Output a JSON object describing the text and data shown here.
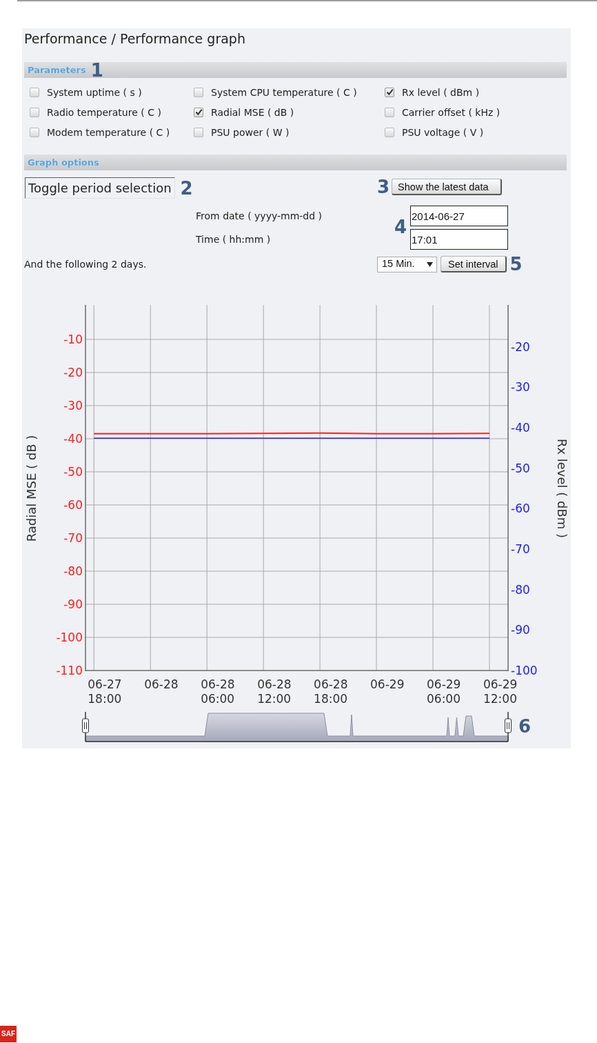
{
  "page_title": "Performance / Performance graph",
  "parameters": {
    "title": "Parameters",
    "callout": "1",
    "items": [
      {
        "label": "System uptime ( s )",
        "checked": false
      },
      {
        "label": "System CPU temperature ( C )",
        "checked": false
      },
      {
        "label": "Rx level ( dBm )",
        "checked": true
      },
      {
        "label": "Radio temperature ( C )",
        "checked": false
      },
      {
        "label": "Radial MSE ( dB )",
        "checked": true
      },
      {
        "label": "Carrier offset ( kHz )",
        "checked": false
      },
      {
        "label": "Modem temperature ( C )",
        "checked": false
      },
      {
        "label": "PSU power ( W )",
        "checked": false
      },
      {
        "label": "PSU voltage ( V )",
        "checked": false
      }
    ]
  },
  "graph_options": {
    "title": "Graph options",
    "period_toggle": {
      "label": "Toggle period selection",
      "callout": "2"
    },
    "latest_button": {
      "label": "Show the latest data",
      "callout": "3"
    },
    "fields": [
      {
        "label": "From date ( yyyy-mm-dd )",
        "value": "2014-06-27"
      },
      {
        "label": "Time ( hh:mm )",
        "value": "17:01"
      }
    ],
    "fields_callout": "4",
    "period_note": "And the following 2 days.",
    "interval": {
      "value": "15 Min.",
      "button": "Set interval",
      "callout": "5"
    }
  },
  "chart": {
    "chart_data": {
      "type": "line",
      "grid": true,
      "ylabel": "Radial MSE ( dB )",
      "y2label": "Rx level ( dBm )",
      "categories": [
        "06-27 18:00",
        "06-28",
        "06-28 06:00",
        "06-28 12:00",
        "06-28 18:00",
        "06-29",
        "06-29 06:00",
        "06-29 12:00"
      ],
      "ylim": [
        -110,
        0
      ],
      "yticks": [
        -10,
        -20,
        -30,
        -40,
        -50,
        -60,
        -70,
        -80,
        -90,
        -100,
        -110
      ],
      "y2lim": [
        -100,
        -10
      ],
      "y2ticks": [
        -20,
        -30,
        -40,
        -50,
        -60,
        -70,
        -80,
        -90,
        -100
      ],
      "series": [
        {
          "color": "#ff2020",
          "values": [
            -38.5,
            -38.5,
            -38.5,
            -38.4,
            -38.3,
            -38.5,
            -38.5,
            -38.4
          ]
        },
        {
          "color": "#2020ff",
          "axis": "y2",
          "values": [
            -42.6,
            -42.6,
            -42.6,
            -42.6,
            -42.6,
            -42.6,
            -42.6,
            -42.6
          ]
        }
      ]
    }
  },
  "navigator": {
    "callout": "6"
  },
  "footer": {
    "logo": "SAF"
  }
}
